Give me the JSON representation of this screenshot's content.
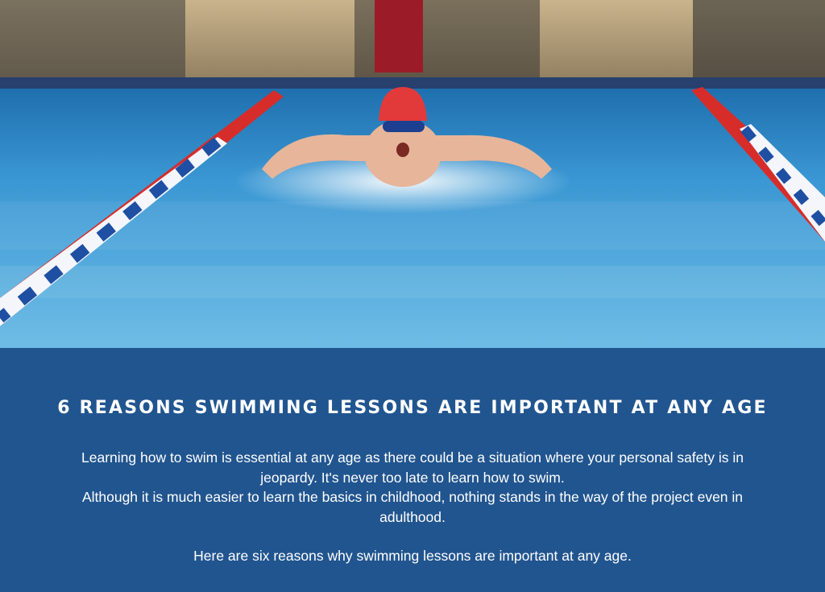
{
  "hero": {
    "image": "swimmer-butterfly-photo",
    "colors": {
      "water": "#3f9fd6",
      "cap": "#e23a3a",
      "lane_red": "#d62d2a",
      "lane_blue": "#1f4fa3",
      "lane_white": "#f4f6fb"
    }
  },
  "article": {
    "title": "6 REASONS SWIMMING LESSONS ARE IMPORTANT AT ANY AGE",
    "paragraph_line_1": "Learning how to swim is essential at any age as there could be a situation where your personal safety is in jeopardy. It's never too late to learn how to swim.",
    "paragraph_line_2": "Although it is much easier to learn the basics in childhood, nothing stands in the way of the project even in adulthood.",
    "closing": "Here are six reasons why swimming lessons are important at any age."
  },
  "theme": {
    "panel_background": "#21558f",
    "text": "#ffffff"
  }
}
